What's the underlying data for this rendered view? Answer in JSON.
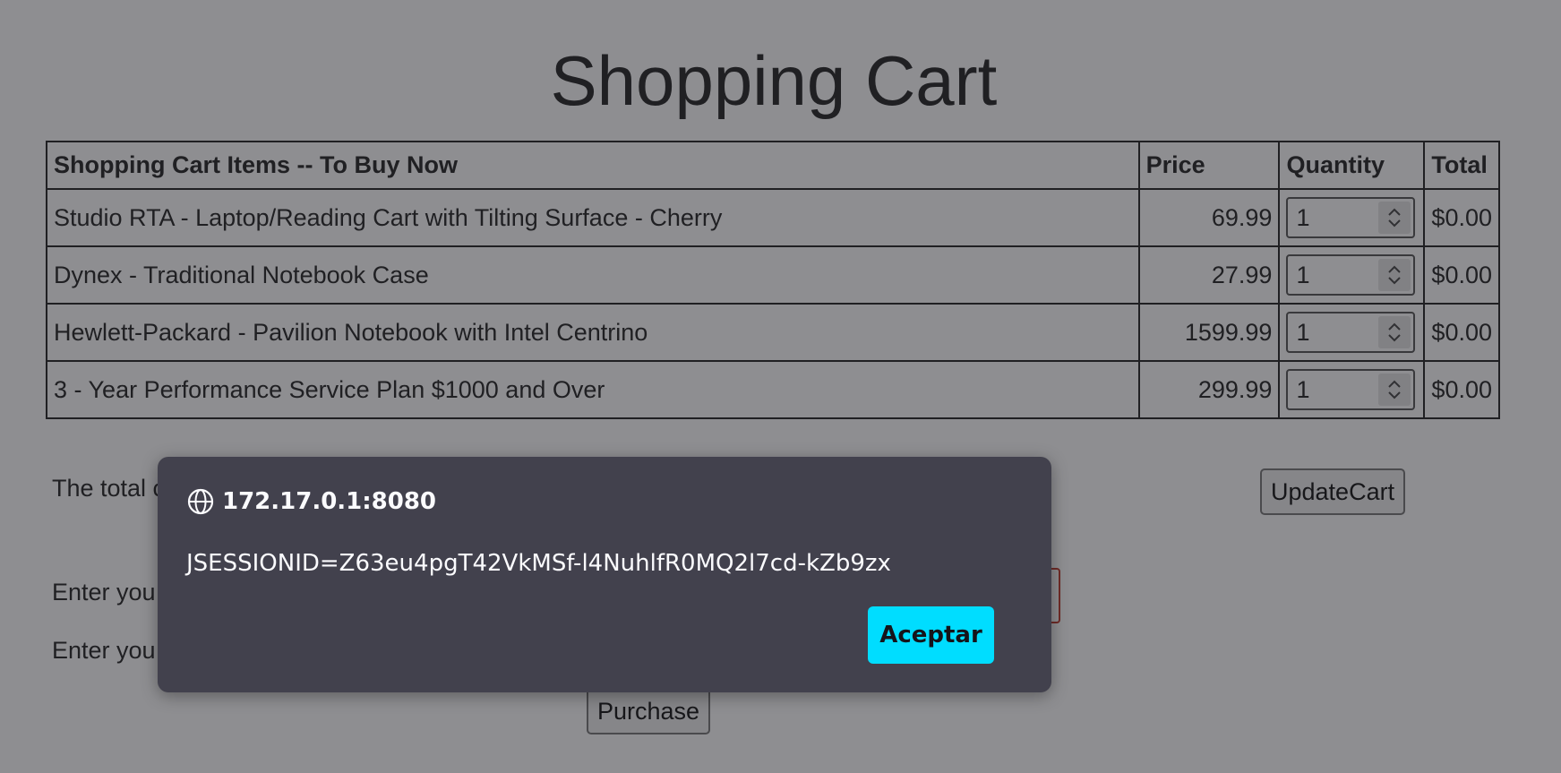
{
  "page": {
    "title": "Shopping Cart"
  },
  "table": {
    "headers": {
      "item": "Shopping Cart Items -- To Buy Now",
      "price": "Price",
      "quantity": "Quantity",
      "total": "Total"
    },
    "rows": [
      {
        "name": "Studio RTA - Laptop/Reading Cart with Tilting Surface - Cherry",
        "price": "69.99",
        "qty": "1",
        "total": "$0.00"
      },
      {
        "name": "Dynex - Traditional Notebook Case",
        "price": "27.99",
        "qty": "1",
        "total": "$0.00"
      },
      {
        "name": "Hewlett-Packard - Pavilion Notebook with Intel Centrino",
        "price": "1599.99",
        "qty": "1",
        "total": "$0.00"
      },
      {
        "name": "3 - Year Performance Service Plan $1000 and Over",
        "price": "299.99",
        "qty": "1",
        "total": "$0.00"
      }
    ]
  },
  "below": {
    "total_label_partial": "The total c",
    "update_button": "UpdateCart",
    "enter_label_1_partial": "Enter you",
    "enter_label_2_partial": "Enter you",
    "purchase_button": "Purchase"
  },
  "dialog": {
    "origin": "172.17.0.1:8080",
    "message": "JSESSIONID=Z63eu4pgT42VkMSf-l4NuhlfR0MQ2l7cd-kZb9zx",
    "ok_label": "Aceptar",
    "icon": "globe-icon",
    "accent_color": "#00ddff",
    "background_color": "#42414d"
  }
}
